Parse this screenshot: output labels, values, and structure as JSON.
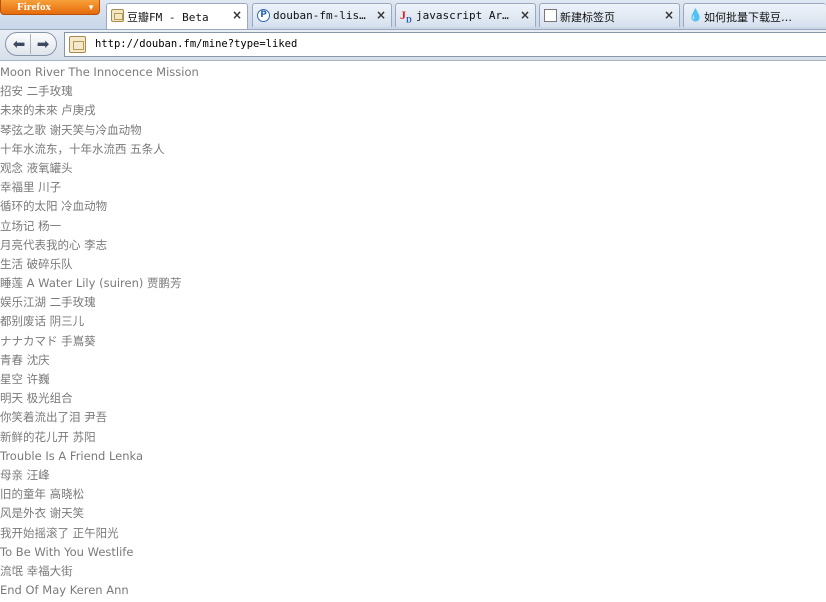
{
  "browser": {
    "app_button_label": "Firefox",
    "tabs": [
      {
        "label": "豆瓣FM - Beta",
        "icon": "douban-icon",
        "active": true
      },
      {
        "label": "douban-fm-list…",
        "icon": "p-site-icon",
        "active": false
      },
      {
        "label": "javascript Arr…",
        "icon": "jd-site-icon",
        "active": false
      },
      {
        "label": "新建标签页",
        "icon": "page-icon",
        "active": false
      },
      {
        "label": "如何批量下载豆…",
        "icon": "droplet-icon",
        "active": false
      }
    ],
    "close_glyph": "×",
    "back_glyph": "⬅",
    "forward_glyph": "➡",
    "url": "http://douban.fm/mine?type=liked"
  },
  "songs": [
    "Moon River The Innocence Mission",
    "招安 二手玫瑰",
    "未來的未來 卢庚戌",
    "琴弦之歌 谢天笑与冷血动物",
    "十年水流东，十年水流西 五条人",
    "观念 液氧罐头",
    "幸福里 川子",
    "循环的太阳 冷血动物",
    "立场记 杨一",
    "月亮代表我的心 李志",
    "生活 破碎乐队",
    "睡莲 A Water Lily (suiren) 贾鹏芳",
    "娱乐江湖 二手玫瑰",
    "都别废话 阴三儿",
    "ナナカマド 手嶌葵",
    "青春 沈庆",
    "星空 许巍",
    "明天 极光组合",
    "你笑着流出了泪 尹吾",
    "新鲜的花儿开 苏阳",
    "Trouble Is A Friend Lenka",
    "母亲 汪峰",
    "旧的童年 高晓松",
    "风是外衣 谢天笑",
    "我开始摇滚了 正午阳光",
    "To Be With You Westlife",
    "流氓 幸福大街",
    "End Of May Keren Ann"
  ]
}
